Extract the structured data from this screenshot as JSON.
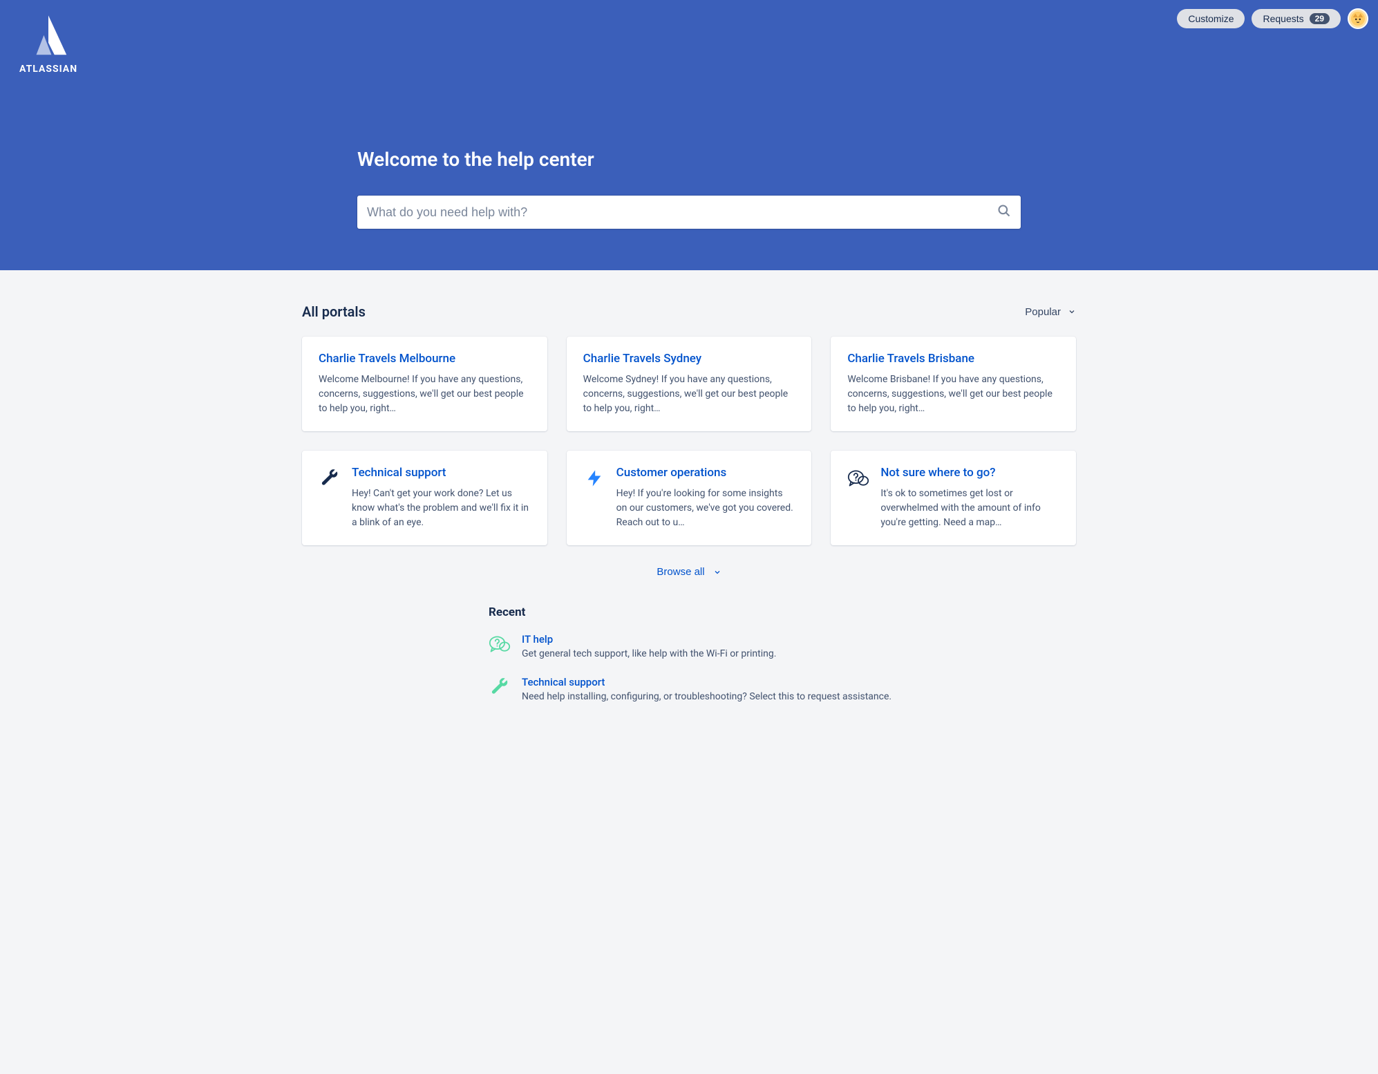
{
  "brand": "ATLASSIAN",
  "header": {
    "customize_label": "Customize",
    "requests_label": "Requests",
    "requests_count": "29"
  },
  "hero": {
    "title": "Welcome to the help center",
    "search_placeholder": "What do you need help with?"
  },
  "portals": {
    "section_title": "All portals",
    "sort_label": "Popular",
    "browse_all_label": "Browse all",
    "cards": [
      {
        "title": "Charlie Travels Melbourne",
        "desc": "Welcome Melbourne! If you have any questions, concerns, suggestions, we'll get our best people to help you, right…"
      },
      {
        "title": "Charlie Travels Sydney",
        "desc": "Welcome Sydney! If you have any questions, concerns, suggestions, we'll get our best people to help you, right…"
      },
      {
        "title": "Charlie Travels Brisbane",
        "desc": "Welcome Brisbane! If you have any questions, concerns, suggestions, we'll get our best people to help you, right…"
      },
      {
        "title": "Technical support",
        "desc": "Hey! Can't get your work done? Let us know what's the problem and we'll fix it in a blink of an eye.",
        "icon": "wrench"
      },
      {
        "title": "Customer operations",
        "desc": "Hey! If you're looking for some insights on our customers, we've got you covered. Reach out to u…",
        "icon": "bolt"
      },
      {
        "title": "Not sure where to go?",
        "desc": "It's ok to sometimes get lost or overwhelmed with the amount of info you're getting. Need a map…",
        "icon": "question"
      }
    ]
  },
  "recent": {
    "section_title": "Recent",
    "items": [
      {
        "title": "IT help",
        "desc": "Get general tech support, like help with the Wi-Fi or printing.",
        "icon": "question-green"
      },
      {
        "title": "Technical support",
        "desc": "Need help installing, configuring, or troubleshooting? Select this to request assistance.",
        "icon": "wrench-green"
      }
    ]
  }
}
